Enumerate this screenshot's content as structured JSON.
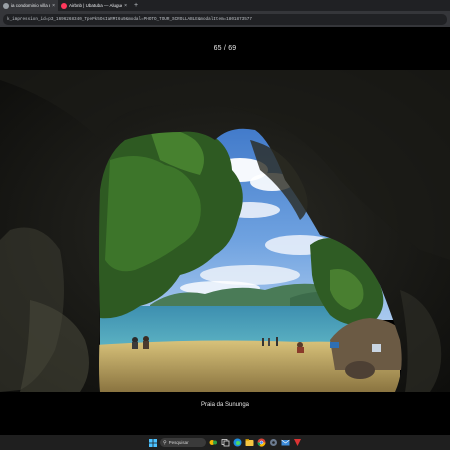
{
  "browser": {
    "tabs": [
      {
        "label": "ia condominio villa maren",
        "close": "×",
        "favicon_color": "#9aa0a6"
      },
      {
        "label": "Airbnb | Ubatuba — Aluguéis",
        "close": "×",
        "favicon_color": "#ff385c"
      }
    ],
    "new_tab": "+",
    "url": "k_impression_id=p3_1696268340_TpePk5OsIaRMt6u9&modal=PHOTO_TOUR_SCROLLABLE&modalItem=1801873577"
  },
  "viewer": {
    "counter": "65 / 69",
    "caption": "Praia da Sununga",
    "photo_description_icon": "cave-beach-photo"
  },
  "taskbar": {
    "search_placeholder": "Pesquisar",
    "icons": [
      "windows-icon",
      "search-icon",
      "widgets-icon",
      "task-view-icon",
      "edge-icon",
      "file-explorer-icon",
      "chrome-icon",
      "settings-icon",
      "mail-icon",
      "app-icon"
    ]
  }
}
